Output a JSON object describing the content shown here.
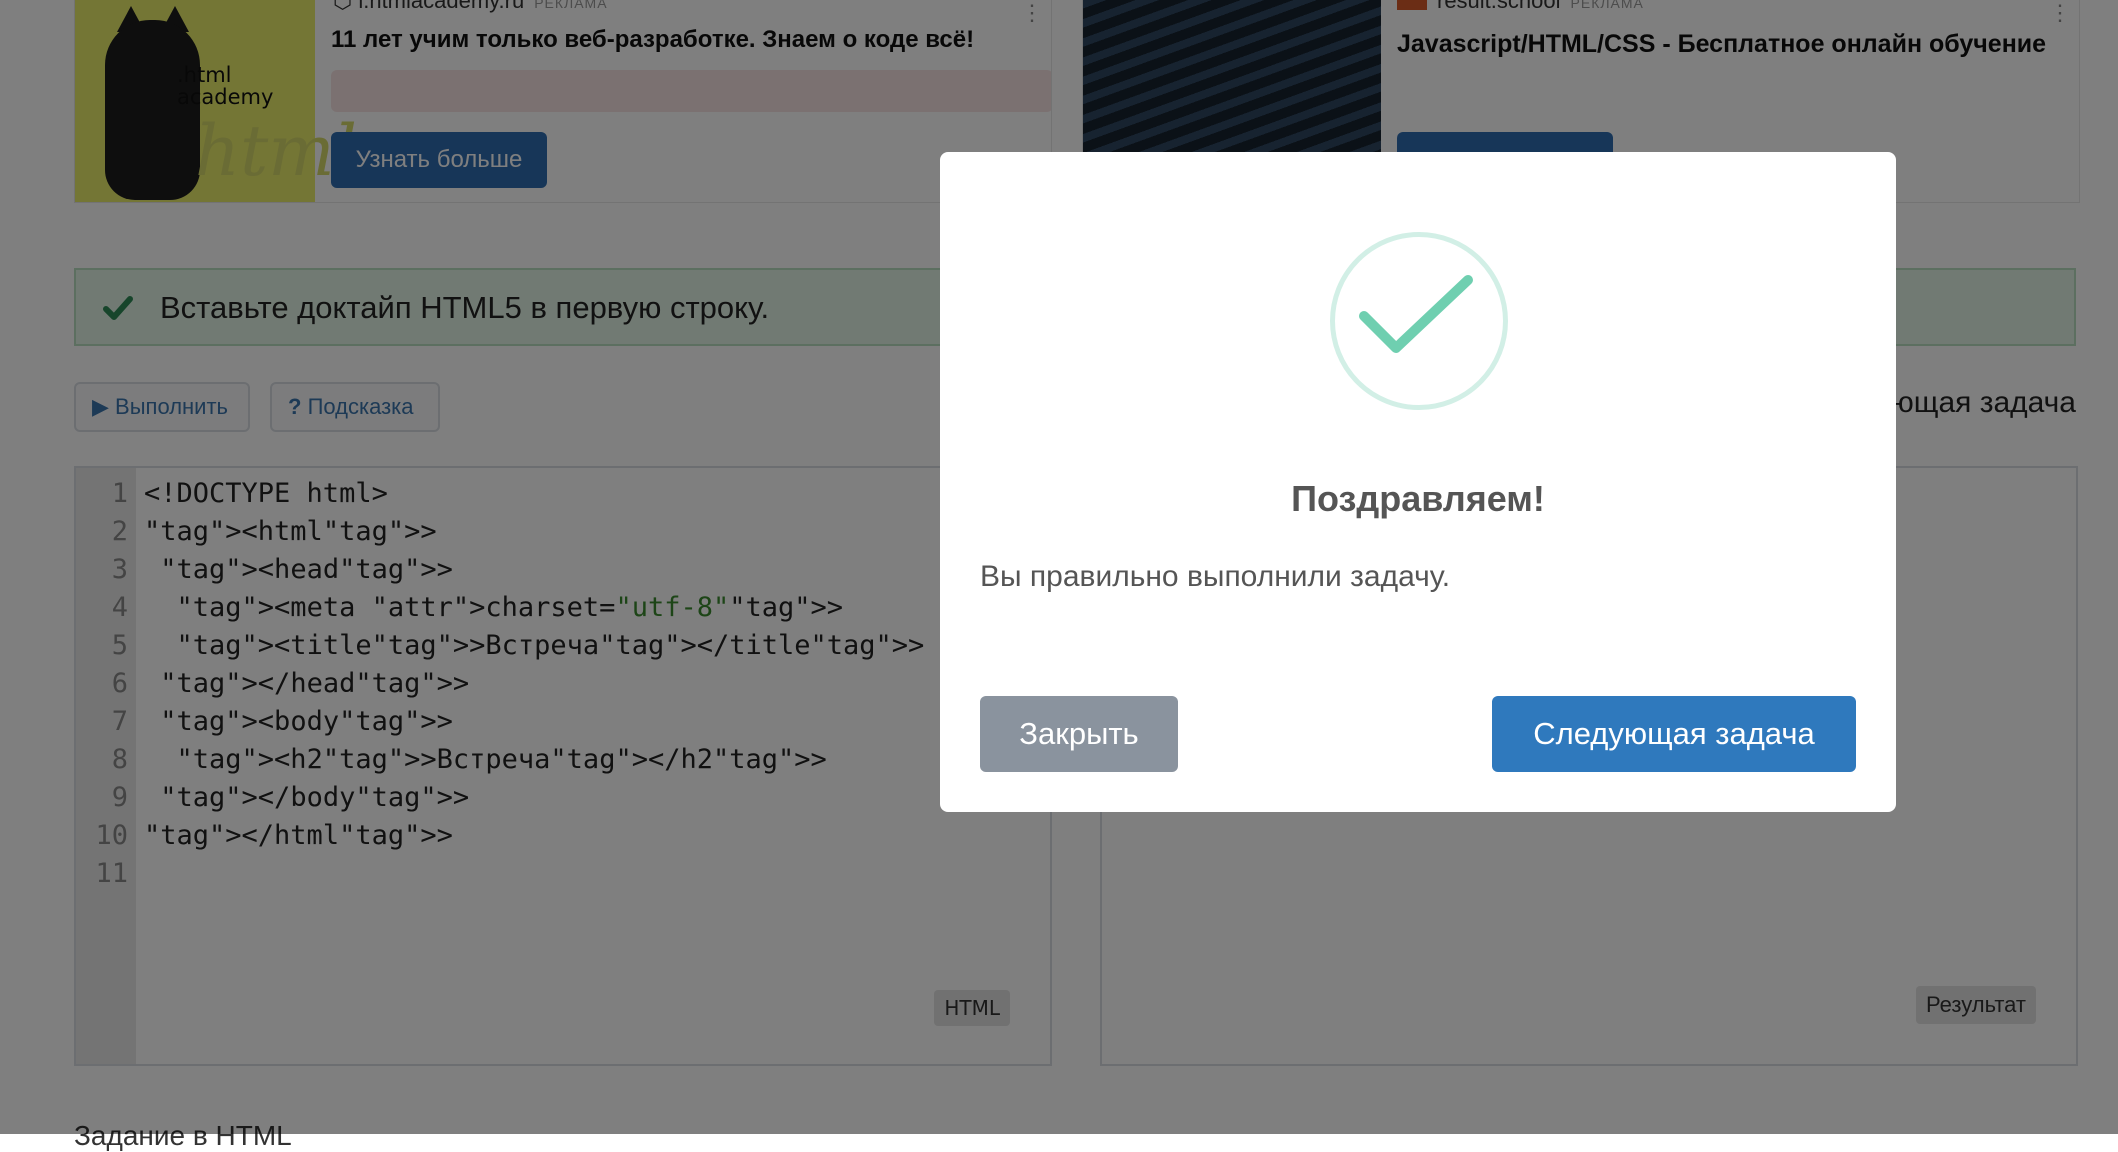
{
  "ads": {
    "left": {
      "logo_line1": ".html",
      "logo_line2": "academy",
      "domain": "l.htmlacademy.ru",
      "ad_label": "РЕКЛАМА",
      "title": "11 лет учим только веб-разработке. Знаем о коде всё!",
      "button": "Узнать больше"
    },
    "right": {
      "domain": "result.school",
      "ad_label": "РЕКЛАМА",
      "title": "Javascript/HTML/CSS - Бесплатное онлайн обучение"
    }
  },
  "task": {
    "text": "Вставьте доктайп HTML5 в первую строку."
  },
  "toolbar": {
    "run_label": "Выполнить",
    "hint_label": "Подсказка",
    "next_task_label": "Следующая задача"
  },
  "editor": {
    "line_numbers": [
      "1",
      "2",
      "3",
      "4",
      "5",
      "6",
      "7",
      "8",
      "9",
      "10",
      "11"
    ],
    "lines": [
      "<!DOCTYPE html>",
      "<html>",
      " <head>",
      "  <meta charset=\"utf-8\">",
      "  <title>Встреча</title>",
      " </head>",
      " <body>",
      "  <h2>Встреча</h2>",
      " </body>",
      "</html>",
      ""
    ],
    "lang_label": "HTML"
  },
  "result": {
    "label": "Результат"
  },
  "bottom": {
    "text": "Задание в HTML"
  },
  "modal": {
    "title": "Поздравляем!",
    "message": "Вы правильно выполнили задачу.",
    "close_label": "Закрыть",
    "next_label": "Следующая задача",
    "accent_color": "#6fcfb0"
  }
}
